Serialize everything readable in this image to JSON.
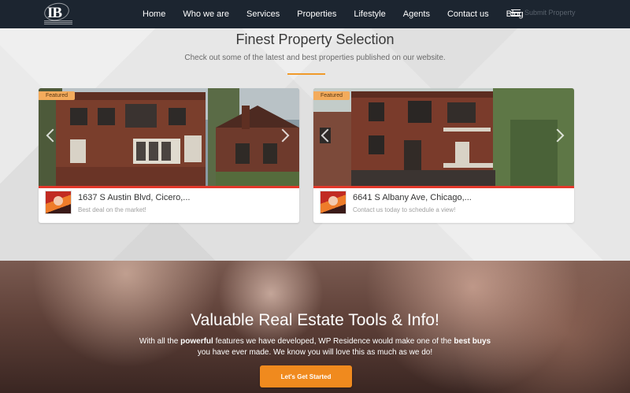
{
  "nav": {
    "logo_text": "IB",
    "items": [
      "Home",
      "Who we are",
      "Services",
      "Properties",
      "Lifestyle",
      "Agents",
      "Contact us",
      "Blog"
    ],
    "submit_label": "Submit Property"
  },
  "section": {
    "title": "Finest Property Selection",
    "subtitle": "Check out some of the latest and best properties published on our website."
  },
  "listings": [
    {
      "badge": "Featured",
      "address": "1637 S Austin Blvd, Cicero,...",
      "description": "Best deal on the market!"
    },
    {
      "badge": "Featured",
      "address": "6641 S Albany Ave, Chicago,...",
      "description": "Contact us today to schedule a view!"
    }
  ],
  "hero": {
    "title": "Valuable Real Estate Tools & Info!",
    "line1_a": "With all the ",
    "line1_b": "powerful",
    "line1_c": " features we have developed, WP Residence would make one of the ",
    "line1_d": "best buys",
    "line2": "you have ever made. We know you will love this as much as we do!",
    "cta_label": "Let's Get Started"
  },
  "colors": {
    "nav_bg": "#1c2530",
    "accent": "#f08a1e",
    "badge": "#f3ab5c",
    "photo_bar": "#e3382b"
  },
  "icons": [
    "menu-icon",
    "chevron-left-icon",
    "chevron-right-icon"
  ]
}
